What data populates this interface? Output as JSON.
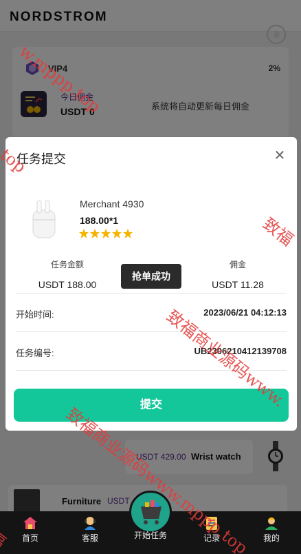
{
  "header": {
    "brand": "NORDSTROM",
    "brand_mark": "®"
  },
  "vip": {
    "level_label": "VIP4",
    "percent": "2%",
    "commission_title": "今日佣金",
    "commission_value": "USDT 0",
    "note": "系统将自动更新每日佣金"
  },
  "background_products": [
    {
      "price": "USDT 429.00",
      "name": "Wrist watch"
    },
    {
      "name": "Furniture",
      "price": "USDT"
    }
  ],
  "modal": {
    "title": "任务提交",
    "close_icon": "close-icon",
    "merchant": "Merchant 4930",
    "price_qty": "188.00*1",
    "rating_stars": 5,
    "task_amount_label": "任务金额",
    "task_amount_value": "USDT 188.00",
    "toast": "抢单成功",
    "commission_label": "佣金",
    "commission_value": "USDT 11.28",
    "start_time_label": "开始时间:",
    "start_time_value": "2023/06/21 04:12:13",
    "task_no_label": "任务编号:",
    "task_no_value": "UB2306210412139708",
    "submit_label": "提交"
  },
  "bottom_nav": {
    "items": [
      {
        "label": "首页",
        "icon": "home-icon"
      },
      {
        "label": "客服",
        "icon": "support-icon"
      },
      {
        "label": "开始任务",
        "icon": "cart-icon"
      },
      {
        "label": "记录",
        "icon": "records-icon"
      },
      {
        "label": "我的",
        "icon": "profile-icon"
      }
    ]
  },
  "watermarks": [
    "w.mppp.top",
    "p.top",
    "致福商业源码www.",
    "致福商业源码www.mppp.top",
    "致福",
    "福"
  ],
  "colors": {
    "accent_green": "#14c79a",
    "purple_text": "#5a2d8c",
    "nav_bg": "#141414",
    "star": "#f5b400"
  }
}
